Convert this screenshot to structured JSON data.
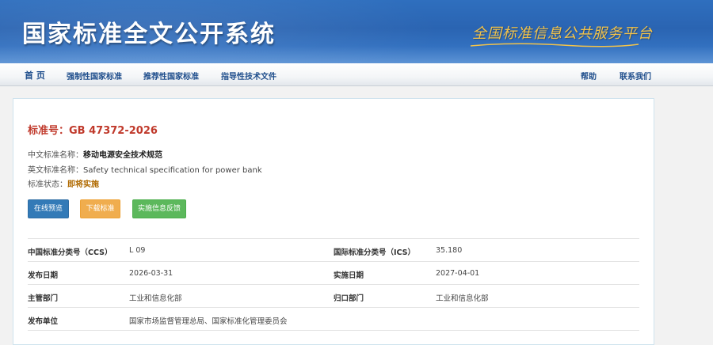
{
  "header": {
    "site_title": "国家标准全文公开系统",
    "slogan": "全国标准信息公共服务平台",
    "colors": {
      "banner": "#2a64b2",
      "slogan": "#f3c34a"
    }
  },
  "nav": {
    "home": "首 页",
    "mandatory": "强制性国家标准",
    "recommended": "推荐性国家标准",
    "guidance": "指导性技术文件",
    "help": "帮助",
    "contact": "联系我们"
  },
  "standard": {
    "number_label": "标准号：GB 47372-2026",
    "cn_name_label": "中文标准名称：",
    "cn_name": "移动电源安全技术规范",
    "en_name_label": "英文标准名称：",
    "en_name": "Safety technical specification for power bank",
    "status_label": "标准状态：",
    "status": "即将实施",
    "status_color": "#b06a00"
  },
  "actions": {
    "preview": "在线预览",
    "download": "下载标准",
    "feedback": "实施信息反馈"
  },
  "details": {
    "ccs_label": "中国标准分类号（CCS）",
    "ccs": "L 09",
    "ics_label": "国际标准分类号（ICS）",
    "ics": "35.180",
    "release_label": "发布日期",
    "release": "2026-03-31",
    "implement_label": "实施日期",
    "implement": "2027-04-01",
    "competent_label": "主管部门",
    "competent": "工业和信息化部",
    "centralized_label": "归口部门",
    "centralized": "工业和信息化部",
    "publisher_label": "发布单位",
    "publisher": "国家市场监督管理总局、国家标准化管理委员会"
  }
}
